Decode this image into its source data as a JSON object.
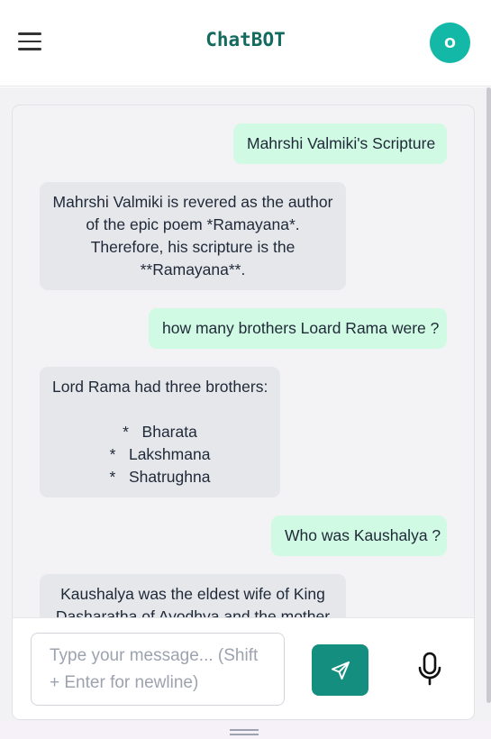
{
  "app": {
    "title": "ChatBOT",
    "avatar_initial": "O"
  },
  "icons": {
    "menu": "hamburger-menu-icon",
    "send": "send-paper-plane-icon",
    "mic": "microphone-icon",
    "handle": "drag-handle-icon"
  },
  "colors": {
    "accent": "#148f7f",
    "title": "#136b5f",
    "avatar_bg": "#14b8a6",
    "user_bubble": "#d1fae5",
    "bot_bubble": "#e5e7eb"
  },
  "messages": [
    {
      "role": "user",
      "lines": [
        "Mahrshi Valmiki's Scripture"
      ]
    },
    {
      "role": "bot",
      "lines": [
        "Mahrshi Valmiki is revered as the author",
        "of the epic poem *Ramayana*.",
        "Therefore, his scripture is the",
        "**Ramayana**."
      ]
    },
    {
      "role": "user",
      "lines": [
        "how many brothers Loard Rama were ?"
      ]
    },
    {
      "role": "bot",
      "lines": [
        "Lord Rama had three brothers:",
        "",
        "*   Bharata",
        "*   Lakshmana",
        "*   Shatrughna"
      ]
    },
    {
      "role": "user",
      "lines": [
        "Who was Kaushalya ?"
      ]
    },
    {
      "role": "bot",
      "lines": [
        "Kaushalya was the eldest wife of King",
        "Dasharatha of Ayodhya and the mother"
      ]
    }
  ],
  "composer": {
    "placeholder_lines": [
      "Type your message... (Shift",
      "+ Enter for newline)"
    ]
  }
}
